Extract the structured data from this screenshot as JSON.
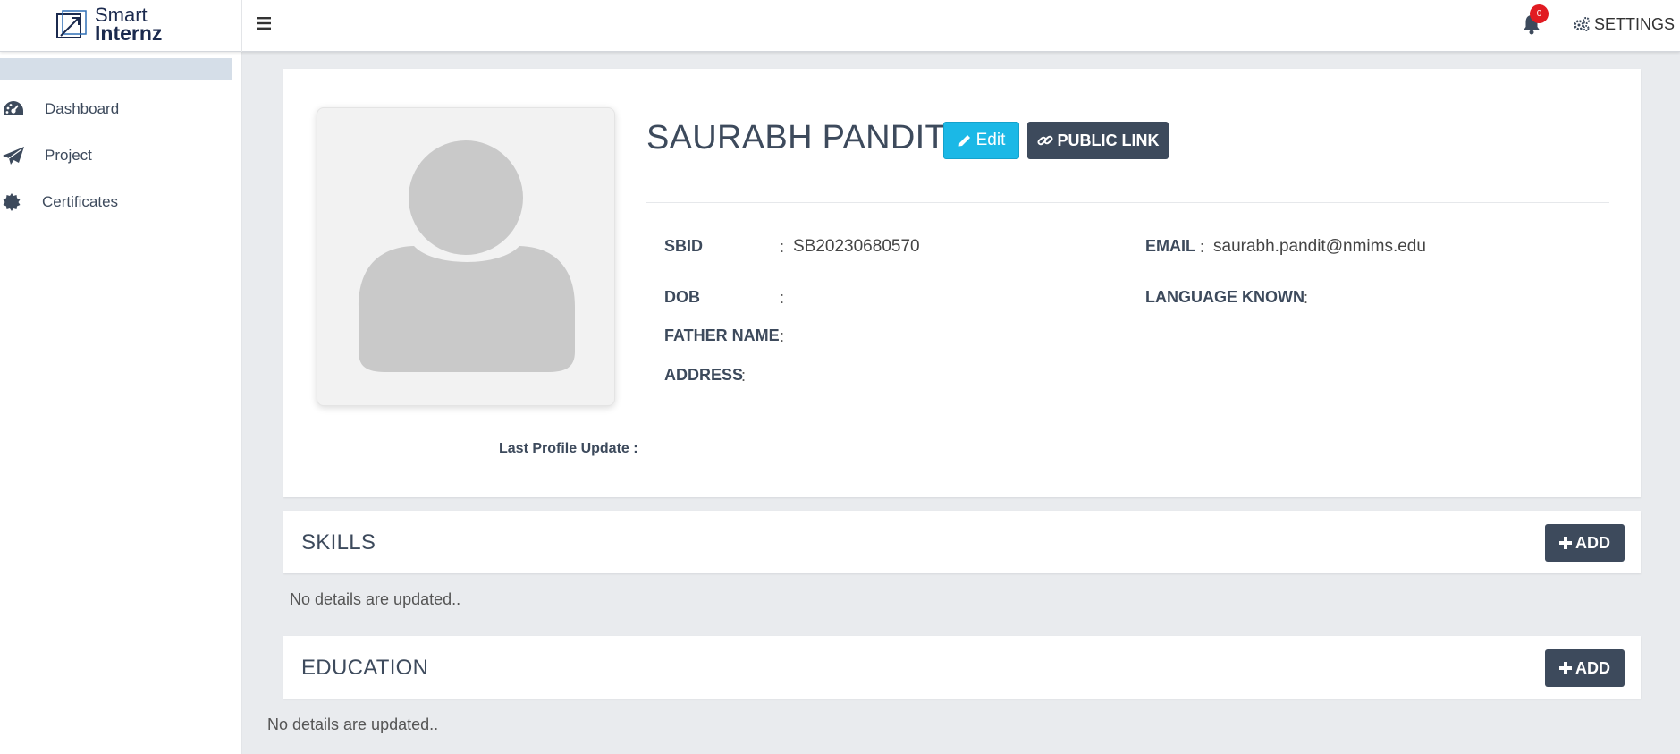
{
  "brand": {
    "line1": "Smart",
    "line2": "Internz"
  },
  "header": {
    "notification_count": "0",
    "settings_label": "SETTINGS"
  },
  "sidebar": {
    "items": [
      {
        "label": "Dashboard",
        "icon": "dashboard-icon"
      },
      {
        "label": "Project",
        "icon": "paper-plane-icon"
      },
      {
        "label": "Certificates",
        "icon": "badge-icon"
      }
    ]
  },
  "profile": {
    "name": "SAURABH PANDIT",
    "edit_label": "Edit",
    "public_link_label": "PUBLIC LINK",
    "last_update_label": "Last Profile Update :",
    "fields": {
      "sbid": {
        "label": "SBID",
        "value": "SB20230680570"
      },
      "email": {
        "label": "EMAIL",
        "value": "saurabh.pandit@nmims.edu"
      },
      "dob": {
        "label": "DOB",
        "value": ""
      },
      "language": {
        "label": "LANGUAGE KNOWN",
        "value": ""
      },
      "father": {
        "label": "FATHER NAME",
        "value": ""
      },
      "address": {
        "label": "ADDRESS",
        "value": ""
      }
    },
    "colon": ":"
  },
  "sections": {
    "skills": {
      "title": "SKILLS",
      "add_label": "ADD",
      "empty": "No details are updated.."
    },
    "education": {
      "title": "EDUCATION",
      "add_label": "ADD",
      "empty": "No details are updated.."
    }
  },
  "colors": {
    "accent": "#1bb8e6",
    "dark_button": "#3d4a5c",
    "badge": "#e11b22"
  }
}
